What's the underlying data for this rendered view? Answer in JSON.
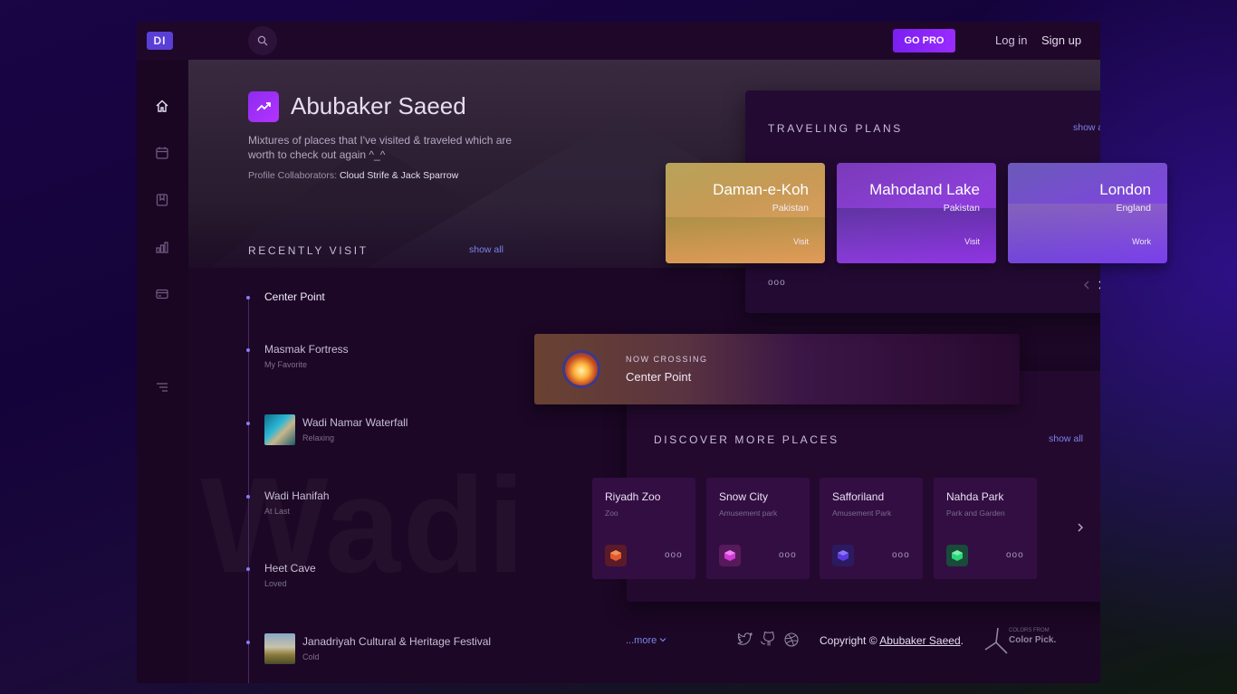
{
  "brand": {
    "logo": "DI"
  },
  "topbar": {
    "gopro": "GO PRO",
    "login": "Log in",
    "signup": "Sign up"
  },
  "profile": {
    "name": "Abubaker Saeed",
    "description": "Mixtures of places that I've visited & traveled which are worth to check out again ^_^",
    "collaborators_label": "Profile Collaborators: ",
    "collaborators": "Cloud Strife & Jack Sparrow"
  },
  "recent": {
    "title": "RECENTLY VISIT",
    "show_all": "show all",
    "items": [
      {
        "title": "Center Point",
        "sub": ""
      },
      {
        "title": "Masmak Fortress",
        "sub": "My Favorite"
      },
      {
        "title": "Wadi Namar Waterfall",
        "sub": "Relaxing"
      },
      {
        "title": "Wadi Hanifah",
        "sub": "At Last"
      },
      {
        "title": "Heet Cave",
        "sub": "Loved"
      },
      {
        "title": "Janadriyah Cultural & Heritage Festival",
        "sub": "Cold"
      }
    ]
  },
  "watermark": "Wadi",
  "plans": {
    "title": "TRAVELING PLANS",
    "show_all": "show all",
    "items": [
      {
        "title": "Daman-e-Koh",
        "country": "Pakistan",
        "kind": "Visit"
      },
      {
        "title": "Mahodand Lake",
        "country": "Pakistan",
        "kind": "Visit"
      },
      {
        "title": "London",
        "country": "England",
        "kind": "Work"
      }
    ],
    "more": "ooo"
  },
  "crossing": {
    "label": "NOW CROSSING",
    "place": "Center Point"
  },
  "discover": {
    "title": "DISCOVER MORE PLACES",
    "show_all": "show all",
    "places": [
      {
        "name": "Riyadh Zoo",
        "type": "Zoo",
        "color": "#e25a2a",
        "bg": "#5a1a2a"
      },
      {
        "name": "Snow City",
        "type": "Amusement park",
        "color": "#d23ad6",
        "bg": "#561a5a"
      },
      {
        "name": "Safforiland",
        "type": "Amusement Park",
        "color": "#5a3ae0",
        "bg": "#2c1a60"
      },
      {
        "name": "Nahda Park",
        "type": "Park and Garden",
        "color": "#2ad67a",
        "bg": "#1a4a3a"
      }
    ],
    "dots": "ooo"
  },
  "footer": {
    "more": "...more",
    "copyright_prefix": "Copyright © ",
    "copyright_name": "Abubaker Saeed",
    "copyright_suffix": ".",
    "colorpick_small": "COLORS FROM",
    "colorpick": "Color Pick."
  }
}
